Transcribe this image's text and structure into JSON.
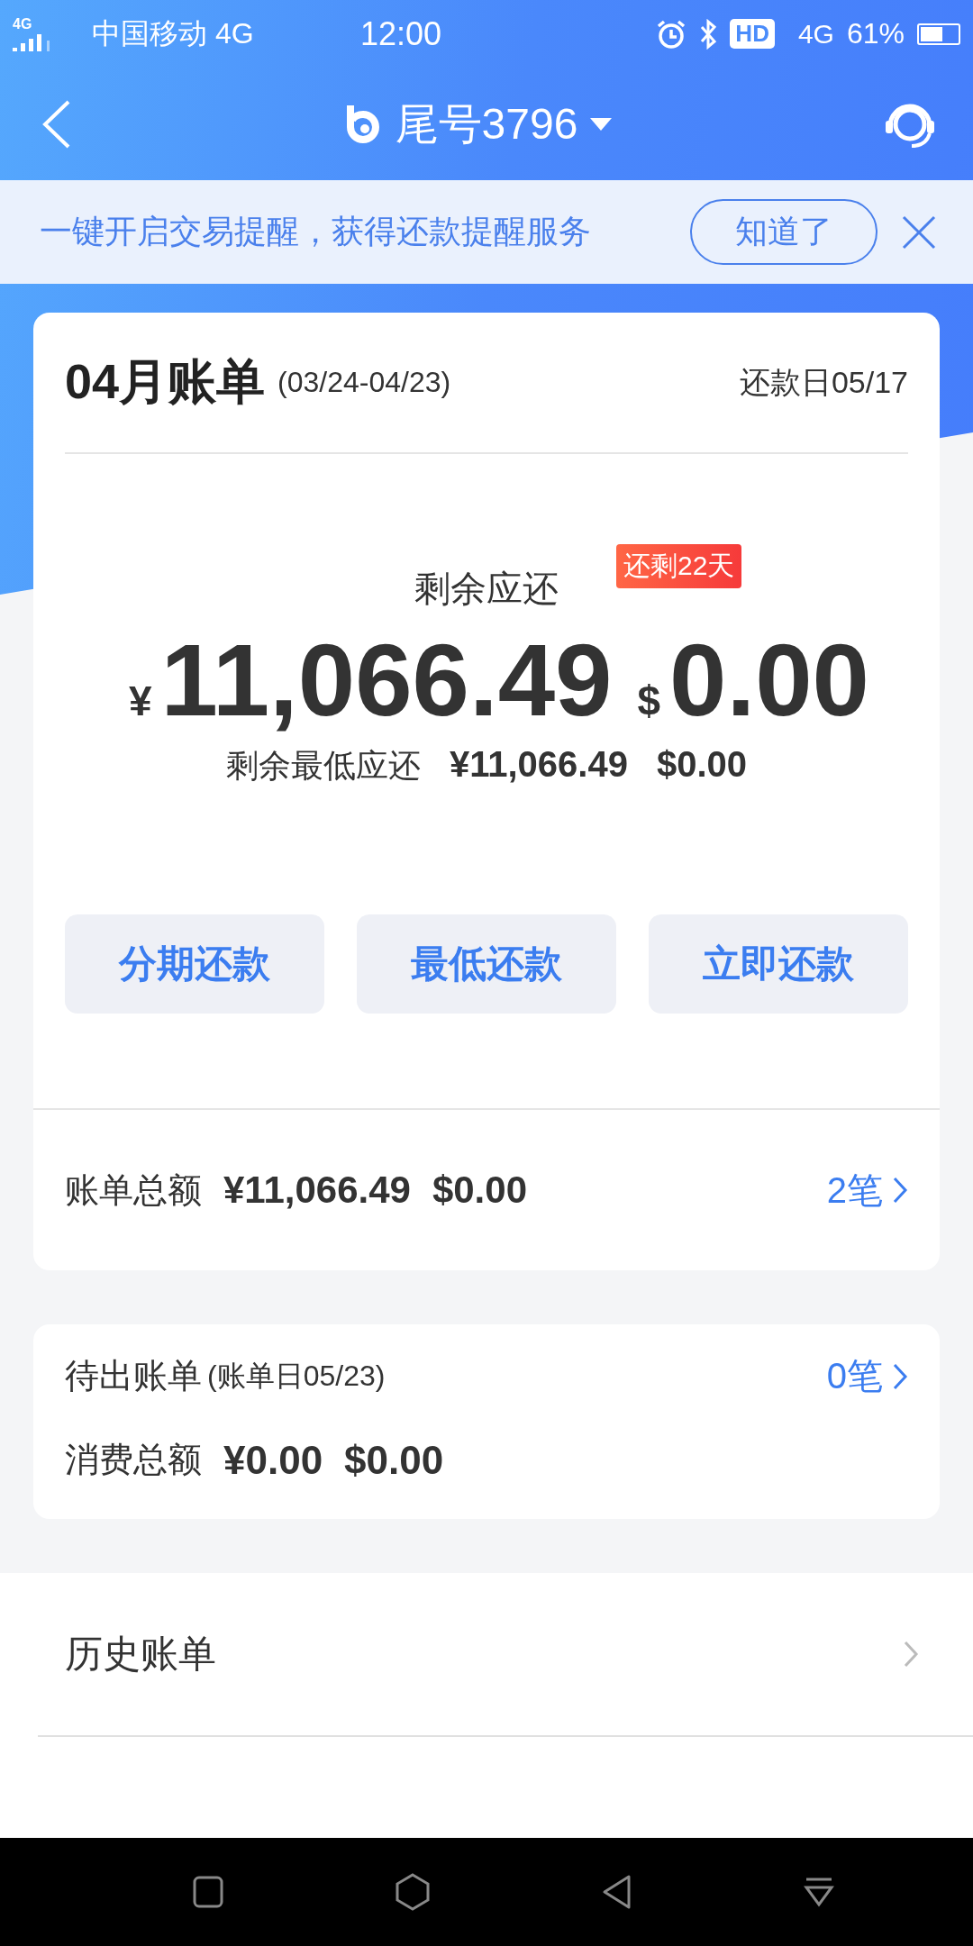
{
  "status_bar": {
    "signal_label": "4G",
    "carrier": "中国移动 4G",
    "time": "12:00",
    "hd": "HD",
    "network": "4G",
    "battery": "61%"
  },
  "header": {
    "title": "尾号3796"
  },
  "banner": {
    "text": "一键开启交易提醒，获得还款提醒服务",
    "button": "知道了"
  },
  "bill": {
    "title": "04月账单",
    "period": "(03/24-04/23)",
    "due_date": "还款日05/17",
    "remaining_label": "剩余应还",
    "badge": "还剩22天",
    "amounts": [
      {
        "symbol": "¥",
        "value": "11,066.49"
      },
      {
        "symbol": "$",
        "value": "0.00"
      }
    ],
    "min_label": "剩余最低应还",
    "min_values": [
      "¥11,066.49",
      "$0.00"
    ],
    "buttons": [
      "分期还款",
      "最低还款",
      "立即还款"
    ],
    "total_label": "账单总额",
    "total_values": [
      "¥11,066.49",
      "$0.00"
    ],
    "total_count": "2笔"
  },
  "pending": {
    "label": "待出账单",
    "note": "(账单日05/23)",
    "count": "0笔",
    "spend_label": "消费总额",
    "spend_values": [
      "¥0.00",
      "$0.00"
    ]
  },
  "history": {
    "label": "历史账单"
  }
}
